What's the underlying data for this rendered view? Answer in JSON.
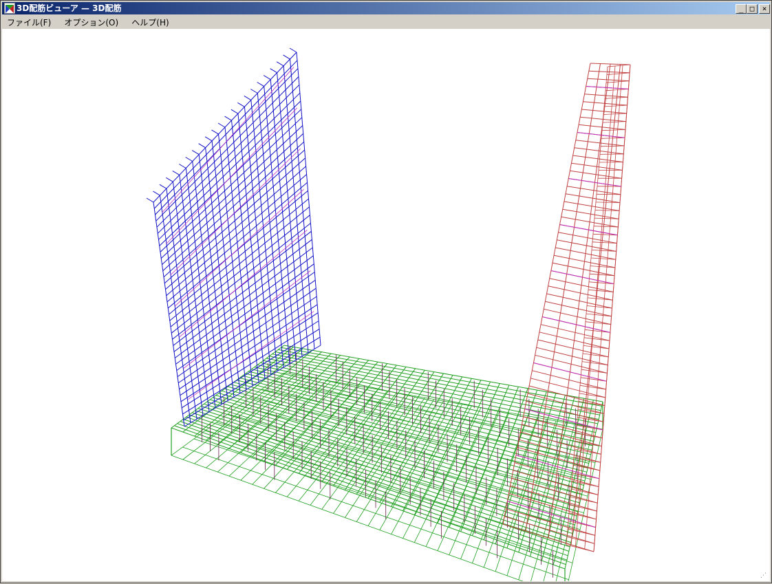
{
  "window": {
    "title": "3D配筋ビューア — 3D配筋",
    "controls": {
      "minimize": "_",
      "maximize": "□",
      "close": "×"
    }
  },
  "menu": {
    "items": [
      {
        "label": "ファイル(F)"
      },
      {
        "label": "オプション(O)"
      },
      {
        "label": "ヘルプ(H)"
      }
    ]
  },
  "viewport": {
    "background": "#ffffff",
    "colors": {
      "left_wall": "#1010c8",
      "right_wall": "#c04040",
      "slab": "#20a020",
      "stirrup": "#c030c0",
      "vertical_bar": "#6a2050"
    }
  },
  "icons": {
    "app": "rebar-viewer-icon",
    "grip": "resize-grip-icon"
  }
}
